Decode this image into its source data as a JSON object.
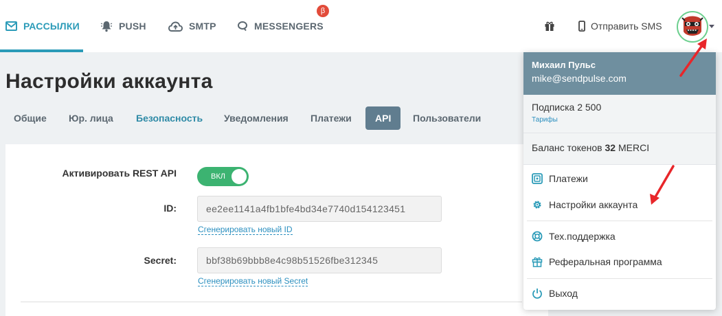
{
  "nav": {
    "items": [
      {
        "label": "РАССЫЛКИ",
        "icon": "envelope-icon",
        "active": true
      },
      {
        "label": "PUSH",
        "icon": "bell-icon"
      },
      {
        "label": "SMTP",
        "icon": "cloud-icon"
      },
      {
        "label": "MESSENGERS",
        "icon": "chat-bubble-icon"
      }
    ],
    "beta_badge": "β",
    "send_sms": "Отправить SMS",
    "accent_color": "#2b9bb8"
  },
  "page": {
    "title": "Настройки аккаунта",
    "tabs": [
      "Общие",
      "Юр. лица",
      "Безопасность",
      "Уведомления",
      "Платежи",
      "API",
      "Пользователи"
    ],
    "active_tab": "API"
  },
  "api": {
    "rest_label": "Активировать REST API",
    "toggle_text": "ВКЛ",
    "toggle_on": true,
    "id_label": "ID:",
    "id_value": "ee2ee1141a4fb1bfe4bd34e7740d154123451",
    "gen_id": "Сгенерировать новый ID",
    "secret_label": "Secret:",
    "secret_value": "bbf38b69bbb8e4c98b51526fbe312345",
    "gen_secret": "Сгенерировать новый Secret"
  },
  "menu": {
    "name": "Михаил Пульс",
    "email": "mike@sendpulse.com",
    "subscription": "Подписка 2 500",
    "plans": "Тарифы",
    "balance_prefix": "Баланс токенов",
    "balance_amount": "32",
    "balance_unit": "MERCI",
    "items": [
      {
        "label": "Платежи",
        "icon": "payments-icon"
      },
      {
        "label": "Настройки аккаунта",
        "icon": "gear-icon"
      },
      {
        "label": "Тех.поддержка",
        "icon": "lifebuoy-icon"
      },
      {
        "label": "Реферальная программа",
        "icon": "gift-icon"
      },
      {
        "label": "Выход",
        "icon": "power-icon"
      }
    ]
  }
}
